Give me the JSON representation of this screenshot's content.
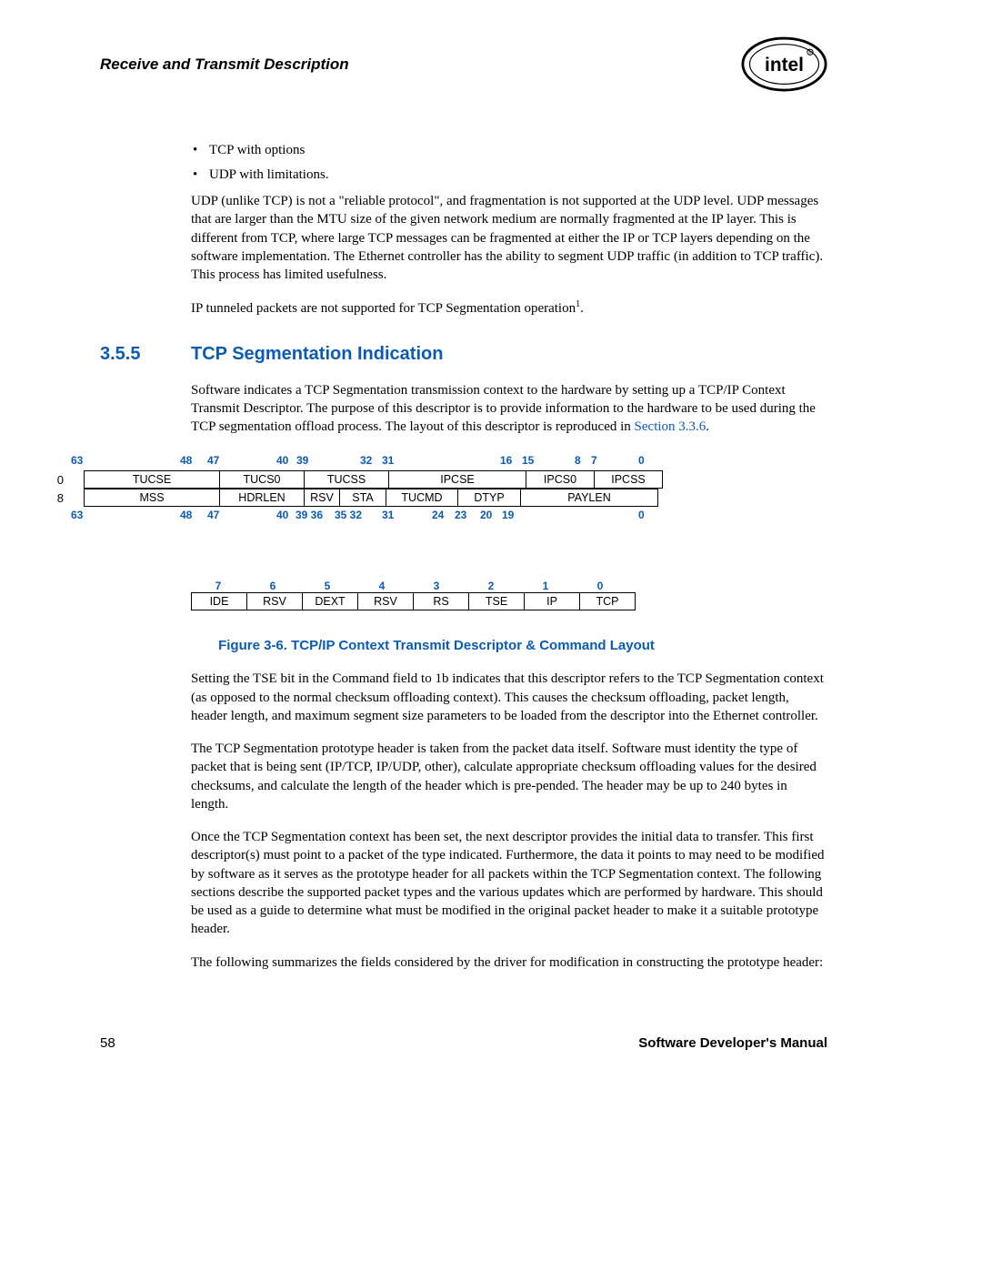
{
  "header": {
    "title": "Receive and Transmit Description",
    "logo_name": "intel-logo"
  },
  "bullets": [
    "TCP with options",
    "UDP with limitations."
  ],
  "para1": "UDP (unlike TCP) is not a \"reliable protocol\", and fragmentation is not supported at the UDP level. UDP messages that are larger than the MTU size of the given network medium are normally fragmented at the IP layer. This is different from TCP, where large TCP messages can be fragmented at either the IP or TCP layers depending on the software implementation. The Ethernet controller has the ability to segment UDP traffic (in addition to TCP traffic). This process has limited usefulness.",
  "para2_pre": "IP tunneled packets are not supported for TCP Segmentation operation",
  "para2_sup": "1",
  "para2_post": ".",
  "section": {
    "num": "3.5.5",
    "title": "TCP Segmentation Indication"
  },
  "para3_pre": "Software indicates a TCP Segmentation transmission context to the hardware by setting up a TCP/IP Context Transmit Descriptor. The purpose of this descriptor is to provide information to the hardware to be used during the TCP segmentation offload process. The layout of this descriptor is reproduced in ",
  "para3_link": "Section 3.3.6",
  "para3_post": ".",
  "bits_top": {
    "p63": "63",
    "p48": "48",
    "p47": "47",
    "p40": "40",
    "p39": "39",
    "p32": "32",
    "p31": "31",
    "p16": "16",
    "p15": "15",
    "p8": "8",
    "p7": "7",
    "p0": "0"
  },
  "row0_label": "0",
  "row0": [
    "TUCSE",
    "TUCS0",
    "TUCSS",
    "IPCSE",
    "IPCS0",
    "IPCSS"
  ],
  "row1_label": "8",
  "row1": [
    "MSS",
    "HDRLEN",
    "RSV",
    "STA",
    "TUCMD",
    "DTYP",
    "PAYLEN"
  ],
  "bits_bot": {
    "p63": "63",
    "p48": "48",
    "p47": "47",
    "p40": "40",
    "p3936": "39 36",
    "p3532": "35 32",
    "p31": "31",
    "p24": "24",
    "p23": "23",
    "p20": "20",
    "p19": "19",
    "p0": "0"
  },
  "bits_small": [
    "7",
    "6",
    "5",
    "4",
    "3",
    "2",
    "1",
    "0"
  ],
  "row_small": [
    "IDE",
    "RSV",
    "DEXT",
    "RSV",
    "RS",
    "TSE",
    "IP",
    "TCP"
  ],
  "figure_caption": "Figure 3-6. TCP/IP Context Transmit Descriptor & Command Layout",
  "para4": "Setting the TSE bit in the Command field to 1b indicates that this descriptor refers to the TCP Segmentation context (as opposed to the normal checksum offloading context). This causes the checksum offloading, packet length, header length, and maximum segment size parameters to be loaded from the descriptor into the Ethernet controller.",
  "para5": "The TCP Segmentation prototype header is taken from the packet data itself. Software must identity the type of packet that is being sent (IP/TCP, IP/UDP, other), calculate appropriate checksum offloading values for the desired checksums, and calculate the length of the header which is pre-pended. The header may be up to 240 bytes in length.",
  "para6": "Once the TCP Segmentation context has been set, the next descriptor provides the initial data to transfer. This first descriptor(s) must point to a packet of the type indicated. Furthermore, the data it points to may need to be modified by software as it serves as the prototype header for all packets within the TCP Segmentation context. The following sections describe the supported packet types and the various updates which are performed by hardware. This should be used as a guide to determine what must be modified in the original packet header to make it a suitable prototype header.",
  "para7": "The following summarizes the fields considered by the driver for modification in constructing the prototype header:",
  "footer": {
    "page": "58",
    "manual": "Software Developer's Manual"
  }
}
